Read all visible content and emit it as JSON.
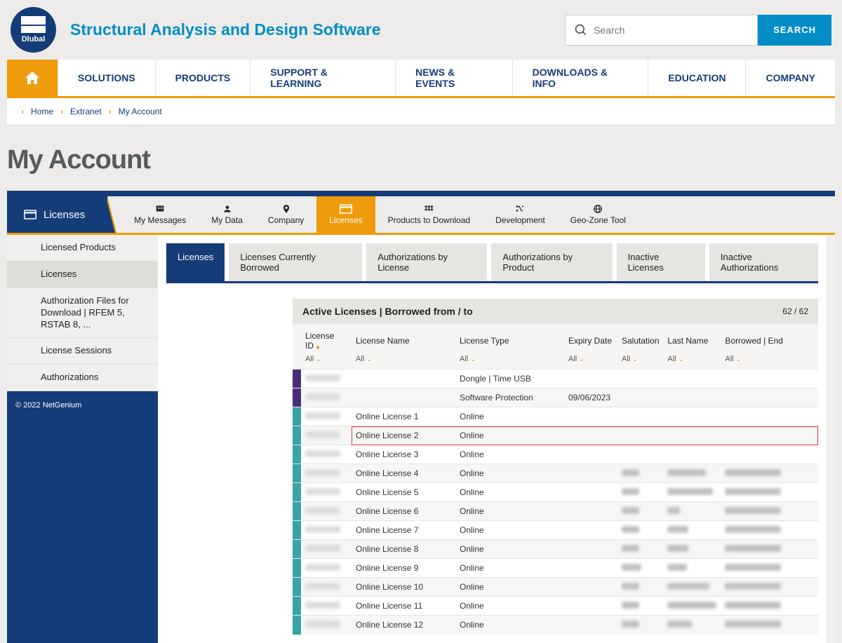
{
  "header": {
    "brand": "Dlubal",
    "tagline": "Structural Analysis and Design Software",
    "search_placeholder": "Search",
    "search_button": "SEARCH"
  },
  "main_nav": [
    "SOLUTIONS",
    "PRODUCTS",
    "SUPPORT & LEARNING",
    "NEWS & EVENTS",
    "DOWNLOADS & INFO",
    "EDUCATION",
    "COMPANY"
  ],
  "breadcrumb": [
    "Home",
    "Extranet",
    "My Account"
  ],
  "page_title": "My Account",
  "account_tabs": {
    "current": "Licenses",
    "items": [
      "My Messages",
      "My Data",
      "Company",
      "Licenses",
      "Products to Download",
      "Development",
      "Geo-Zone Tool"
    ],
    "active_index": 3
  },
  "sidebar": {
    "items": [
      "Licensed Products",
      "Licenses",
      "Authorization Files for Download | RFEM 5, RSTAB 8, ...",
      "License Sessions",
      "Authorizations"
    ],
    "active_index": 1,
    "copyright": "© 2022 NetGenium"
  },
  "subtabs": {
    "items": [
      "Licenses",
      "Licenses Currently Borrowed",
      "Authorizations by License",
      "Authorizations by Product",
      "Inactive Licenses",
      "Inactive Authorizations"
    ],
    "active_index": 0
  },
  "table": {
    "heading": "Active Licenses | Borrowed from / to",
    "counter": "62 / 62",
    "columns": [
      "License ID",
      "License Name",
      "License Type",
      "Expiry Date",
      "Salutation",
      "Last Name",
      "Borrowed | End"
    ],
    "filter_label": "All",
    "rows": [
      {
        "id_hidden": true,
        "name": "",
        "type": "Dongle | Time USB",
        "expiry": "",
        "sal": "",
        "last": "",
        "borrow": "",
        "mark": "purple"
      },
      {
        "id_hidden": true,
        "name": "",
        "type": "Software Protection",
        "expiry": "09/06/2023",
        "sal": "",
        "last": "",
        "borrow": "",
        "mark": "purple"
      },
      {
        "id_hidden": true,
        "name": "Online License 1",
        "type": "Online",
        "expiry": "",
        "sal": "",
        "last": "",
        "borrow": "",
        "mark": "teal"
      },
      {
        "id_hidden": true,
        "name": "Online License 2",
        "type": "Online",
        "expiry": "",
        "sal": "",
        "last": "",
        "borrow": "",
        "mark": "teal",
        "highlight": true
      },
      {
        "id_hidden": true,
        "name": "Online License 3",
        "type": "Online",
        "expiry": "",
        "sal": "",
        "last": "",
        "borrow": "",
        "mark": "teal"
      },
      {
        "id_hidden": true,
        "name": "Online License 4",
        "type": "Online",
        "expiry": "",
        "sal_blur": 25,
        "last_blur": 55,
        "borrow_blur": 80,
        "mark": "teal"
      },
      {
        "id_hidden": true,
        "name": "Online License 5",
        "type": "Online",
        "expiry": "",
        "sal_blur": 25,
        "last_blur": 65,
        "borrow_blur": 80,
        "mark": "teal"
      },
      {
        "id_hidden": true,
        "name": "Online License 6",
        "type": "Online",
        "expiry": "",
        "sal_blur": 25,
        "last_blur": 18,
        "borrow_blur": 80,
        "mark": "teal"
      },
      {
        "id_hidden": true,
        "name": "Online License 7",
        "type": "Online",
        "expiry": "",
        "sal_blur": 25,
        "last_blur": 30,
        "borrow_blur": 80,
        "mark": "teal"
      },
      {
        "id_hidden": true,
        "name": "Online License 8",
        "type": "Online",
        "expiry": "",
        "sal_blur": 25,
        "last_blur": 30,
        "borrow_blur": 80,
        "mark": "teal"
      },
      {
        "id_hidden": true,
        "name": "Online License 9",
        "type": "Online",
        "expiry": "",
        "sal_blur": 28,
        "last_blur": 28,
        "borrow_blur": 80,
        "mark": "teal"
      },
      {
        "id_hidden": true,
        "name": "Online License 10",
        "type": "Online",
        "expiry": "",
        "sal_blur": 25,
        "last_blur": 60,
        "borrow_blur": 80,
        "mark": "teal"
      },
      {
        "id_hidden": true,
        "name": "Online License 11",
        "type": "Online",
        "expiry": "",
        "sal_blur": 25,
        "last_blur": 70,
        "borrow_blur": 80,
        "mark": "teal"
      },
      {
        "id_hidden": true,
        "name": "Online License 12",
        "type": "Online",
        "expiry": "",
        "sal_blur": 25,
        "last_blur": 35,
        "borrow_blur": 80,
        "mark": "teal"
      }
    ]
  }
}
